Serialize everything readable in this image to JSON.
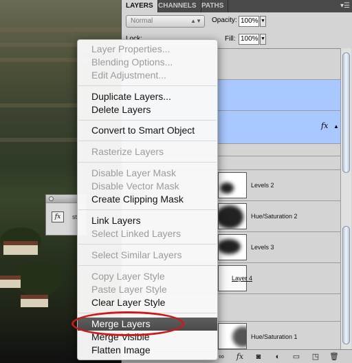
{
  "panel": {
    "tabs": [
      {
        "label": "LAYERS",
        "active": true
      },
      {
        "label": "CHANNELS",
        "active": false
      },
      {
        "label": "PATHS",
        "active": false
      }
    ],
    "menu_icon": "panel-menu-icon",
    "blend_mode": "Normal",
    "opacity_label": "Opacity:",
    "opacity_value": "100%",
    "lock_label": "Lock:",
    "fill_label": "Fill:",
    "fill_value": "100%",
    "layers": [
      {
        "name": "Levels 2",
        "selected": false
      },
      {
        "name": "Hue/Saturation 2",
        "selected": false
      },
      {
        "name": "Levels 3",
        "selected": false
      },
      {
        "name": "Layer 4",
        "selected": false
      },
      {
        "name": "Hue/Saturation 1",
        "selected": false
      }
    ],
    "fx_label": "fx"
  },
  "doc_window": {
    "label": "st",
    "fx": "fx"
  },
  "context_menu": {
    "items": [
      {
        "label": "Layer Properties...",
        "enabled": false
      },
      {
        "label": "Blending Options...",
        "enabled": false
      },
      {
        "label": "Edit Adjustment...",
        "enabled": false
      },
      {
        "label": "Duplicate Layers...",
        "enabled": true
      },
      {
        "label": "Delete Layers",
        "enabled": true
      },
      {
        "label": "Convert to Smart Object",
        "enabled": true
      },
      {
        "label": "Rasterize Layers",
        "enabled": false
      },
      {
        "label": "Disable Layer Mask",
        "enabled": false
      },
      {
        "label": "Disable Vector Mask",
        "enabled": false
      },
      {
        "label": "Create Clipping Mask",
        "enabled": true
      },
      {
        "label": "Link Layers",
        "enabled": true
      },
      {
        "label": "Select Linked Layers",
        "enabled": false
      },
      {
        "label": "Select Similar Layers",
        "enabled": false
      },
      {
        "label": "Copy Layer Style",
        "enabled": false
      },
      {
        "label": "Paste Layer Style",
        "enabled": false
      },
      {
        "label": "Clear Layer Style",
        "enabled": true
      },
      {
        "label": "Merge Layers",
        "enabled": true,
        "highlighted": true
      },
      {
        "label": "Merge Visible",
        "enabled": true
      },
      {
        "label": "Flatten Image",
        "enabled": true
      }
    ]
  },
  "colors": {
    "selection_highlight": "#a8c8ff",
    "menu_highlight": "#505050",
    "annotation_ellipse": "#d01818"
  }
}
